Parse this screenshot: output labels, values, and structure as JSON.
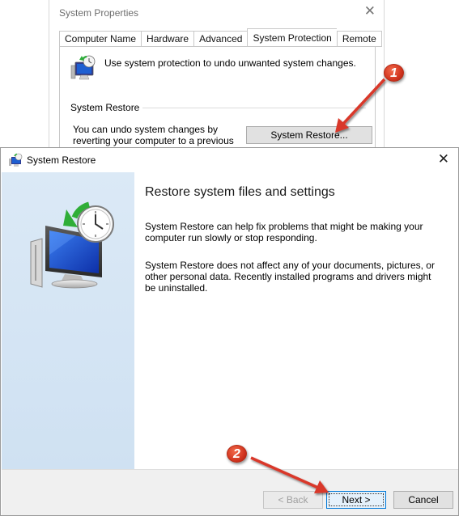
{
  "system_properties": {
    "title": "System Properties",
    "close_glyph": "✕",
    "tabs": [
      {
        "label": "Computer Name",
        "active": false
      },
      {
        "label": "Hardware",
        "active": false
      },
      {
        "label": "Advanced",
        "active": false
      },
      {
        "label": "System Protection",
        "active": true
      },
      {
        "label": "Remote",
        "active": false
      }
    ],
    "description": "Use system protection to undo unwanted system changes.",
    "section_label": "System Restore",
    "undo_text": "You can undo system changes by reverting your computer to a previous restore point.",
    "system_restore_button": "System Restore..."
  },
  "wizard": {
    "title": "System Restore",
    "close_glyph": "✕",
    "heading": "Restore system files and settings",
    "paragraph1": "System Restore can help fix problems that might be making your computer run slowly or stop responding.",
    "paragraph2": "System Restore does not affect any of your documents, pictures, or other personal data. Recently installed programs and drivers might be uninstalled.",
    "buttons": {
      "back": "< Back",
      "next": "Next >",
      "cancel": "Cancel"
    }
  },
  "annotations": {
    "badge1": "1",
    "badge2": "2",
    "arrow_color": "#d9382a"
  }
}
